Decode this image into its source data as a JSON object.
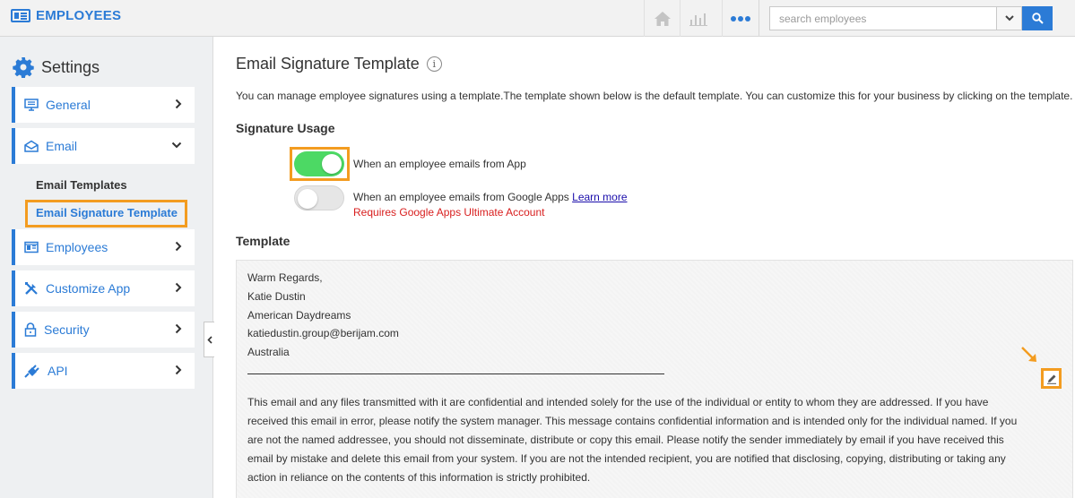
{
  "header": {
    "app_title": "EMPLOYEES",
    "search_placeholder": "search employees",
    "icons": [
      "home-icon",
      "chart-icon",
      "more-icon",
      "caret-down-icon",
      "search-icon"
    ]
  },
  "sidebar": {
    "title": "Settings",
    "items": [
      {
        "label": "General",
        "icon": "monitor-icon",
        "chevron": "right"
      },
      {
        "label": "Email",
        "icon": "envelope-icon",
        "chevron": "down"
      },
      {
        "label": "Employees",
        "icon": "id-card-icon",
        "chevron": "right"
      },
      {
        "label": "Customize App",
        "icon": "tools-icon",
        "chevron": "right"
      },
      {
        "label": "Security",
        "icon": "lock-icon",
        "chevron": "right"
      },
      {
        "label": "API",
        "icon": "plug-icon",
        "chevron": "right"
      }
    ],
    "email_subitems": [
      "Email Templates",
      "Email Signature Template"
    ],
    "active_subitem": "Email Signature Template"
  },
  "main": {
    "title": "Email Signature Template",
    "description": "You can manage employee signatures using a template.The template shown below is the default template. You can customize this for your business by clicking on the template.",
    "signature_usage": {
      "heading": "Signature Usage",
      "app_toggle": {
        "label": "When an employee emails from App",
        "on": true
      },
      "google_toggle": {
        "label": "When an employee emails from Google Apps",
        "link": "Learn more",
        "on": false
      },
      "warning": "Requires Google Apps Ultimate Account"
    },
    "template": {
      "heading": "Template",
      "lines": [
        "Warm Regards,",
        "Katie  Dustin",
        "American Daydreams",
        "katiedustin.group@berijam.com",
        "Australia"
      ],
      "disclaimer": "This email and any files transmitted with it are confidential and intended solely for the use of the individual or entity to whom they are addressed. If you have received this email in error, please notify the system manager. This message contains confidential information and is intended only for the individual named. If you are not the named addressee, you should not disseminate, distribute or copy this email. Please notify the sender immediately by email if you have received this email by mistake and delete this email from your system. If you are not the intended recipient, you are notified that disclosing, copying, distributing or taking any action in reliance on the contents of this information is strictly prohibited."
    }
  },
  "colors": {
    "accent": "#2b7bd6",
    "highlight": "#f39c20",
    "toggle_on": "#4cd964",
    "warning": "#d81e1e"
  }
}
